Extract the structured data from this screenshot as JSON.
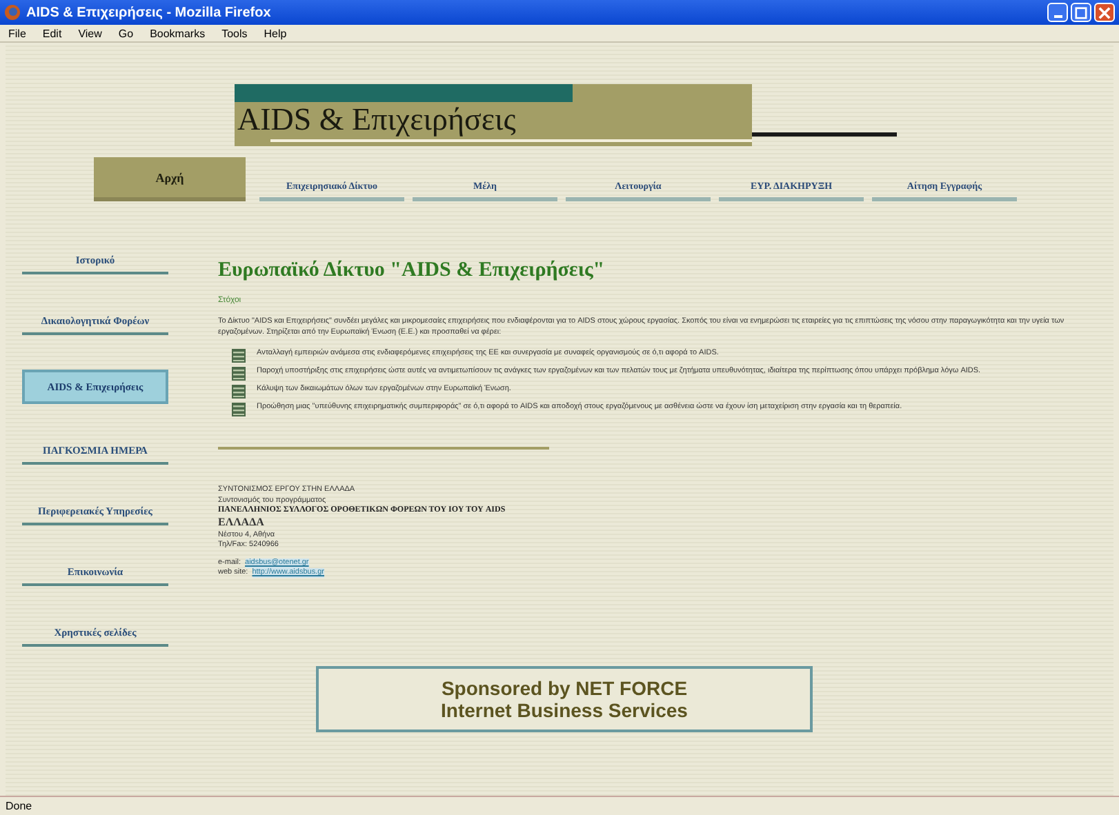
{
  "window": {
    "title": "AIDS & Επιχειρήσεις - Mozilla Firefox"
  },
  "menu": [
    "File",
    "Edit",
    "View",
    "Go",
    "Bookmarks",
    "Tools",
    "Help"
  ],
  "logo": {
    "title": "AIDS & Επιχειρήσεις"
  },
  "tabs": [
    {
      "label": "Αρχή",
      "selected": true
    },
    {
      "label": "Επιχειρησιακό Δίκτυο",
      "selected": false
    },
    {
      "label": "Μέλη",
      "selected": false
    },
    {
      "label": "Λειτουργία",
      "selected": false
    },
    {
      "label": "ΕΥΡ. ΔΙΑΚΗΡΥΞΗ",
      "selected": false
    },
    {
      "label": "Αίτηση Εγγραφής",
      "selected": false
    }
  ],
  "sidebar": {
    "items": [
      {
        "label": "Ιστορικό",
        "selected": false
      },
      {
        "label": "Δικαιολογητικά Φορέων",
        "selected": false
      },
      {
        "label": "AIDS & Επιχειρήσεις",
        "selected": true
      },
      {
        "label": "ΠΑΓΚΟΣΜΙΑ ΗΜΕΡΑ",
        "selected": false
      },
      {
        "label": "Περιφερειακές Υπηρεσίες",
        "selected": false
      },
      {
        "label": "Επικοινωνία",
        "selected": false
      },
      {
        "label": "Χρηστικές σελίδες",
        "selected": false
      }
    ]
  },
  "article": {
    "heading": "Ευρωπαϊκό Δίκτυο \"AIDS & Επιχειρήσεις\"",
    "subheading": "Στόχοι",
    "intro": "Το Δίκτυο \"AIDS και Επιχειρήσεις\" συνδέει μεγάλες και μικρομεσαίες επιχειρήσεις που ενδιαφέρονται για το AIDS στους χώρους εργασίας. Σκοπός του είναι να ενημερώσει τις εταιρείες για τις επιπτώσεις της νόσου στην παραγωγικότητα και την υγεία των εργαζομένων. Στηρίζεται από την Ευρωπαϊκή Ένωση (Ε.Ε.) και προσπαθεί να φέρει:",
    "bullets": [
      "Ανταλλαγή εμπειριών ανάμεσα στις ενδιαφερόμενες επιχειρήσεις της ΕΕ και συνεργασία με συναφείς οργανισμούς σε ό,τι αφορά το AIDS.",
      "Παροχή υποστήριξης στις επιχειρήσεις ώστε αυτές να αντιμετωπίσουν τις ανάγκες των εργαζομένων και των πελατών τους με ζητήματα υπευθυνότητας, ιδιαίτερα της περίπτωσης όπου υπάρχει πρόβλημα λόγω AIDS.",
      "Κάλυψη των δικαιωμάτων όλων των εργαζομένων στην Ευρωπαϊκή Ένωση.",
      "Προώθηση μιας \"υπεύθυνης επιχειρηματικής συμπεριφοράς\" σε ό,τι αφορά το AIDS και αποδοχή στους εργαζόμενους με ασθένεια ώστε να έχουν ίση μεταχείριση στην εργασία και τη θεραπεία."
    ]
  },
  "contact": {
    "lines": [
      "ΣΥΝΤΟΝΙΣΜΟΣ ΕΡΓΟΥ ΣΤΗΝ ΕΛΛΑΔΑ",
      "Συντονισμός του προγράμματος"
    ],
    "org": "ΠΑΝΕΛΛΗΝΙΟΣ ΣΥΛΛΟΓΟΣ ΟΡΟΘΕΤΙΚΩΝ ΦΟΡΕΩΝ ΤΟΥ ΙΟΥ ΤΟΥ AIDS",
    "country": "ΕΛΛΑΔΑ",
    "address": [
      "Νέστου 4, Αθήνα",
      "Τηλ/Fax: 5240966"
    ],
    "email_label": "e-mail:",
    "email": "aidsbus@otenet.gr",
    "web_label": "web site:",
    "web": "http://www.aidsbus.gr"
  },
  "sponsor": [
    "Sponsored by NET FORCE",
    "Internet Business Services"
  ],
  "status_bar": "Done"
}
